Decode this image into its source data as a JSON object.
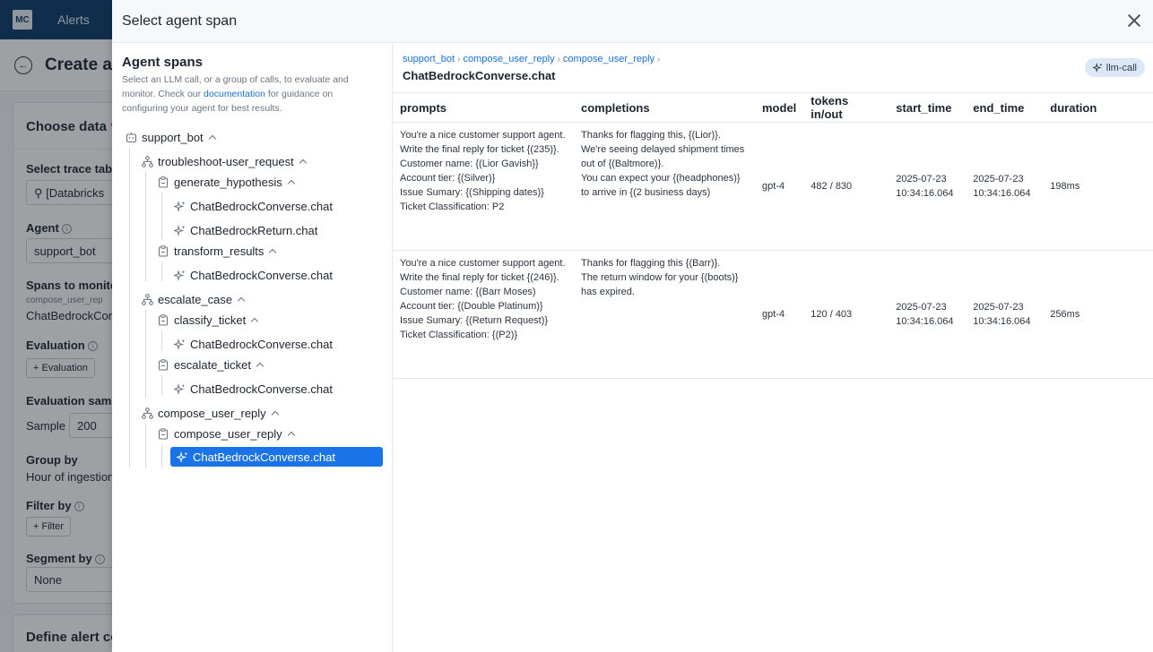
{
  "background": {
    "logo": "MC",
    "nav_alerts": "Alerts",
    "page_title": "Create a",
    "choose_data": "Choose data",
    "required_mark": "*",
    "select_trace_table_label": "Select trace tab",
    "trace_table_value": "[Databricks",
    "agent_label": "Agent",
    "agent_value": "support_bot",
    "spans_to_monitor_label": "Spans to monito",
    "spans_path_small": "compose_user_rep",
    "spans_value": "ChatBedrockCor",
    "evaluation_label": "Evaluation",
    "evaluation_button": "+ Evaluation",
    "evaluation_sample_label": "Evaluation samp",
    "sample_label": "Sample",
    "sample_value": "200",
    "group_by_label": "Group by",
    "group_by_value": "Hour of ingestion",
    "filter_by_label": "Filter by",
    "filter_button": "+ Filter",
    "segment_by_label": "Segment by",
    "segment_value": "None",
    "define_alert": "Define alert co"
  },
  "modal": {
    "title": "Select agent span",
    "close_icon": "close-icon"
  },
  "tree_pane": {
    "title": "Agent spans",
    "desc_before": "Select an LLM call, or a group of calls, to evaluate and monitor. Check our ",
    "desc_link": "documentation",
    "desc_after": " for guidance on configuring your agent for best results.",
    "nodes": [
      {
        "label": "support_bot",
        "icon": "robot-icon"
      },
      {
        "label": "troubleshoot-user_request",
        "icon": "workflow-icon"
      },
      {
        "label": "generate_hypothesis",
        "icon": "clipboard-icon"
      },
      {
        "label": "ChatBedrockConverse.chat",
        "icon": "sparkle-icon"
      },
      {
        "label": "ChatBedrockReturn.chat",
        "icon": "sparkle-icon"
      },
      {
        "label": "transform_results",
        "icon": "clipboard-icon"
      },
      {
        "label": "ChatBedrockConverse.chat",
        "icon": "sparkle-icon"
      },
      {
        "label": "escalate_case",
        "icon": "workflow-icon"
      },
      {
        "label": "classify_ticket",
        "icon": "clipboard-icon"
      },
      {
        "label": "ChatBedrockConverse.chat",
        "icon": "sparkle-icon"
      },
      {
        "label": "escalate_ticket",
        "icon": "clipboard-icon"
      },
      {
        "label": "ChatBedrockConverse.chat",
        "icon": "sparkle-icon"
      },
      {
        "label": "compose_user_reply",
        "icon": "workflow-icon"
      },
      {
        "label": "compose_user_reply",
        "icon": "clipboard-icon"
      },
      {
        "label": "ChatBedrockConverse.chat",
        "icon": "sparkle-icon",
        "selected": true
      }
    ]
  },
  "detail": {
    "breadcrumb": [
      "support_bot",
      "compose_user_reply",
      "compose_user_reply"
    ],
    "span_title": "ChatBedrockConverse.chat",
    "badge": "llm-call",
    "columns": [
      "prompts",
      "completions",
      "model",
      "tokens in/out",
      "start_time",
      "end_time",
      "duration"
    ],
    "rows": [
      {
        "prompts": "You're a nice customer support agent.\nWrite the final reply for ticket {(235)}.\nCustomer name: {(Lior Gavish}}\nAccount tier: {(Silver)}\nIssue Sumary: {(Shipping dates)}\nTicket Classification: P2",
        "completions": "Thanks for flagging this, {(Lior)}.\nWe're seeing delayed shipment times out of {(Baltmore)}.\nYou can expect your {(headphones)} to arrive in {(2 business days)",
        "model": "gpt-4",
        "tokens": "482 / 830",
        "start_time": "2025-07-23\n10:34:16.064",
        "end_time": "2025-07-23\n10:34:16.064",
        "duration": "198ms"
      },
      {
        "prompts": "You're a nice customer support agent.\nWrite the final reply for ticket {(246)}.\nCustomer name: {(Barr Moses)\nAccount tier: {(Double Platinum)}\nIssue Sumary: {(Return Request)}\nTicket Classification: {(P2)}",
        "completions": "Thanks for flagging this {(Barr)}.\nThe return window for your {(boots)} has expired.",
        "model": "gpt-4",
        "tokens": "120 / 403",
        "start_time": "2025-07-23\n10:34:16.064",
        "end_time": "2025-07-23\n10:34:16.064",
        "duration": "256ms"
      }
    ]
  }
}
